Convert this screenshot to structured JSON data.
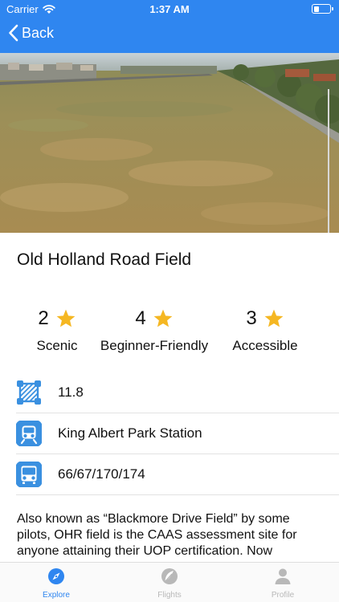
{
  "status_bar": {
    "carrier": "Carrier",
    "time": "1:37 AM",
    "battery_level": 0.35
  },
  "nav": {
    "back_label": "Back"
  },
  "field": {
    "name": "Old Holland Road Field"
  },
  "ratings": [
    {
      "value": "2",
      "label": "Scenic"
    },
    {
      "value": "4",
      "label": "Beginner-Friendly"
    },
    {
      "value": "3",
      "label": "Accessible"
    }
  ],
  "info": {
    "area": "11.8",
    "mrt_station": "King Albert Park Station",
    "bus_numbers": "66/67/170/174"
  },
  "description": "Also known as “Blackmore Drive Field” by some pilots, OHR field is the CAAS assessment site for anyone attaining their UOP certification. Now",
  "tabs": [
    {
      "label": "Explore",
      "icon": "compass-icon",
      "active": true
    },
    {
      "label": "Flights",
      "icon": "drone-icon",
      "active": false
    },
    {
      "label": "Profile",
      "icon": "person-icon",
      "active": false
    }
  ],
  "colors": {
    "accent": "#2f86f0",
    "star": "#f5b722",
    "info_icon": "#3a90e0",
    "tab_inactive": "#b8b8b8"
  }
}
